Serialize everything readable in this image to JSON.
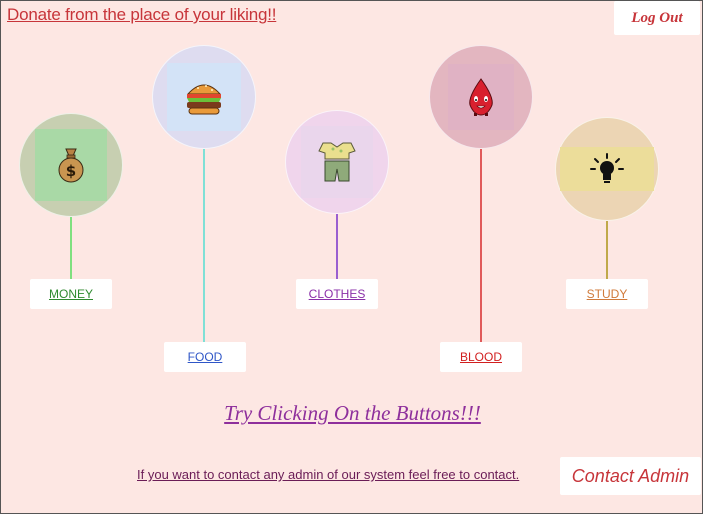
{
  "header": {
    "donate_link": "Donate from the place of your liking!!",
    "logout_label": "Log Out"
  },
  "categories": [
    {
      "label": "MONEY",
      "icon": "money-bag-icon",
      "color": "#2f8a2f"
    },
    {
      "label": "FOOD",
      "icon": "burger-icon",
      "color": "#2f56c7"
    },
    {
      "label": "CLOTHES",
      "icon": "clothes-icon",
      "color": "#8a2fa8"
    },
    {
      "label": "BLOOD",
      "icon": "blood-drop-icon",
      "color": "#d11f1f"
    },
    {
      "label": "STUDY",
      "icon": "light-bulb-icon",
      "color": "#d07a3a"
    }
  ],
  "hint": "Try Clicking On the Buttons!!!",
  "footer": {
    "contact_text": "If you want to contact any admin of our system feel free to contact.",
    "contact_button": "Contact Admin"
  }
}
